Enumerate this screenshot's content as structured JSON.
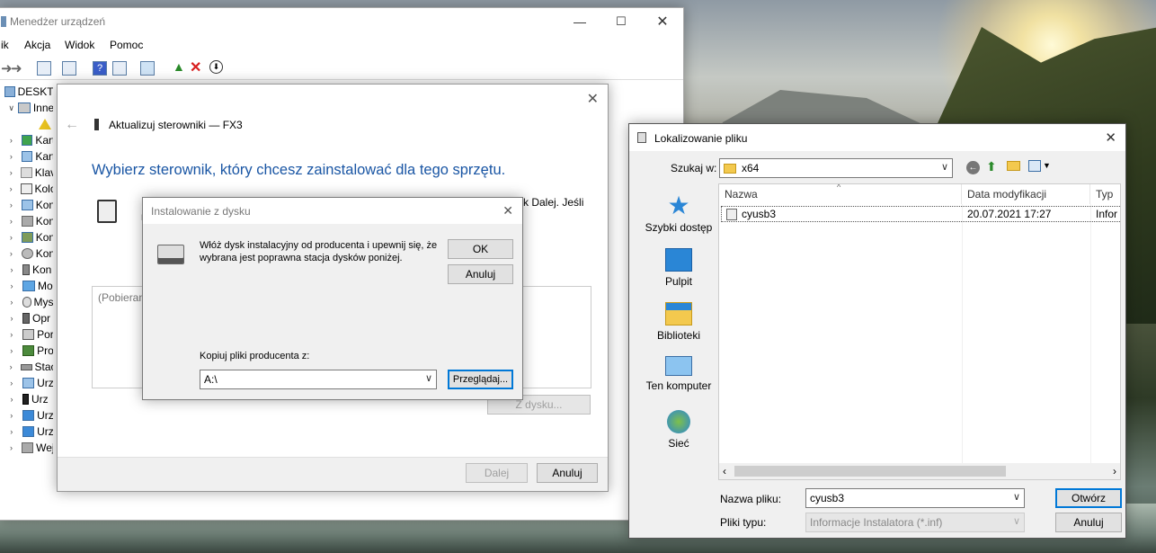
{
  "device_manager": {
    "title": "Menedżer urządzeń",
    "menu": [
      "ik",
      "Akcja",
      "Widok",
      "Pomoc"
    ],
    "root_label": "DESKTO",
    "tree": [
      "Inne",
      "",
      "Kart",
      "Kart",
      "Klav",
      "Kolo",
      "Kon",
      "Kon",
      "Kon",
      "Kon",
      "Kon",
      "Mo",
      "Mys",
      "Opr",
      "Por",
      "Pro",
      "Stac",
      "Urz",
      "Urz",
      "Urz",
      "Urz",
      "Wej"
    ]
  },
  "update_driver": {
    "title": "Aktualizuj sterowniki — FX3",
    "heading": "Wybierz sterownik, który chcesz zainstalować dla tego sprzętu.",
    "body_left": "K",
    "body_left2": "n",
    "body_right": "k Dalej. Jeśli",
    "list_text": "(Pobieran",
    "from_disk_button": "Z dysku...",
    "next_button": "Dalej",
    "cancel_button": "Anuluj"
  },
  "install_from_disk": {
    "title": "Instalowanie z dysku",
    "message": "Włóż dysk instalacyjny od producenta i upewnij się, że wybrana jest poprawna stacja dysków poniżej.",
    "ok_button": "OK",
    "cancel_button": "Anuluj",
    "copy_label": "Kopiuj pliki producenta z:",
    "copy_value": "A:\\",
    "browse_button": "Przeglądaj..."
  },
  "locate_file": {
    "title": "Lokalizowanie pliku",
    "look_in_label": "Szukaj w:",
    "look_in_value": "x64",
    "places": [
      "Szybki dostęp",
      "Pulpit",
      "Biblioteki",
      "Ten komputer",
      "Sieć"
    ],
    "columns": [
      "Nazwa",
      "Data modyfikacji",
      "Typ"
    ],
    "files": [
      {
        "name": "cyusb3",
        "date": "20.07.2021 17:27",
        "type": "Infor"
      }
    ],
    "filename_label": "Nazwa pliku:",
    "filename_value": "cyusb3",
    "filetype_label": "Pliki typu:",
    "filetype_value": "Informacje Instalatora (*.inf)",
    "open_button": "Otwórz",
    "cancel_button": "Anuluj"
  },
  "colors": {
    "accent": "#0078d7",
    "heading": "#1a56a4"
  }
}
